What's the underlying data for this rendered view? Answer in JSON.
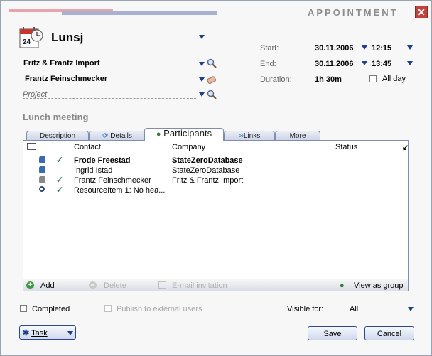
{
  "window": {
    "title": "APPOINTMENT",
    "close_glyph": "✕"
  },
  "appointment": {
    "title": "Lunsj",
    "calendar_icon_day": "24",
    "company": "Fritz & Frantz Import",
    "contact": "Frantz Feinschmecker",
    "project_placeholder": "Project",
    "section_title": "Lunch meeting"
  },
  "time": {
    "start_label": "Start:",
    "start_date": "30.11.2006",
    "start_time": "12:15",
    "end_label": "End:",
    "end_date": "30.11.2006",
    "end_time": "13:45",
    "duration_label": "Duration:",
    "duration_value": "1h 30m",
    "allday_label": "All day"
  },
  "tabs": [
    {
      "label": "Description"
    },
    {
      "label": "Details"
    },
    {
      "label": "Participants"
    },
    {
      "label": "Links"
    },
    {
      "label": "More"
    }
  ],
  "participants": {
    "columns": {
      "contact": "Contact",
      "company": "Company",
      "status": "Status"
    },
    "rows": [
      {
        "contact": "Frode Freestad",
        "company": "StateZeroDatabase",
        "bold": true
      },
      {
        "contact": "Ingrid Istad",
        "company": "StateZeroDatabase"
      },
      {
        "contact": "Frantz Feinschmecker",
        "company": "Fritz & Frantz Import"
      },
      {
        "contact": "ResourceItem 1: No hea...",
        "company": ""
      }
    ],
    "toolbar": {
      "add": "Add",
      "delete": "Delete",
      "email": "E-mail invitation",
      "view_group": "View as group"
    }
  },
  "footer": {
    "completed": "Completed",
    "publish": "Publish to external users",
    "visible_label": "Visible for:",
    "visible_value": "All",
    "task": "Task",
    "save": "Save",
    "cancel": "Cancel"
  },
  "colors": {
    "accent_blue": "#1e3f8a",
    "pink_stripe": "#e9a3ad",
    "blue_stripe": "#a9b1d3",
    "close_red": "#c0443e",
    "check_green": "#2a7a3b"
  }
}
